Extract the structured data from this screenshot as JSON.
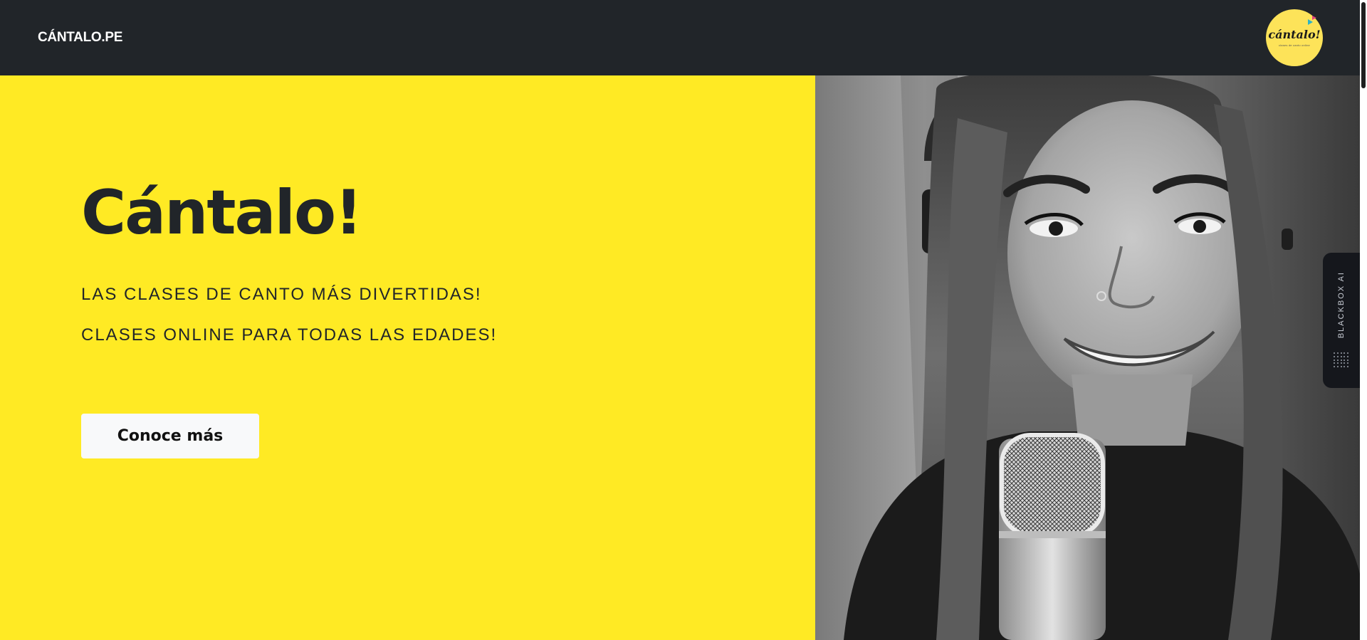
{
  "navbar": {
    "brand": "CÁNTALO.PE",
    "logo_text": "cántalo!",
    "logo_subtitle": "clases de canto online"
  },
  "hero": {
    "title": "Cántalo!",
    "line1": "LAS CLASES DE CANTO MÁS DIVERTIDAS!",
    "line2": "CLASES ONLINE PARA TODAS LAS EDADES!",
    "cta_label": "Conoce más"
  },
  "photo": {
    "description_icon": "singer-with-microphone-photo"
  },
  "side_widget": {
    "label": "BLACKBOX AI"
  },
  "colors": {
    "navbar_bg": "#212529",
    "hero_bg": "#ffea24",
    "text_dark": "#212529",
    "button_bg": "#f8f9fa"
  }
}
